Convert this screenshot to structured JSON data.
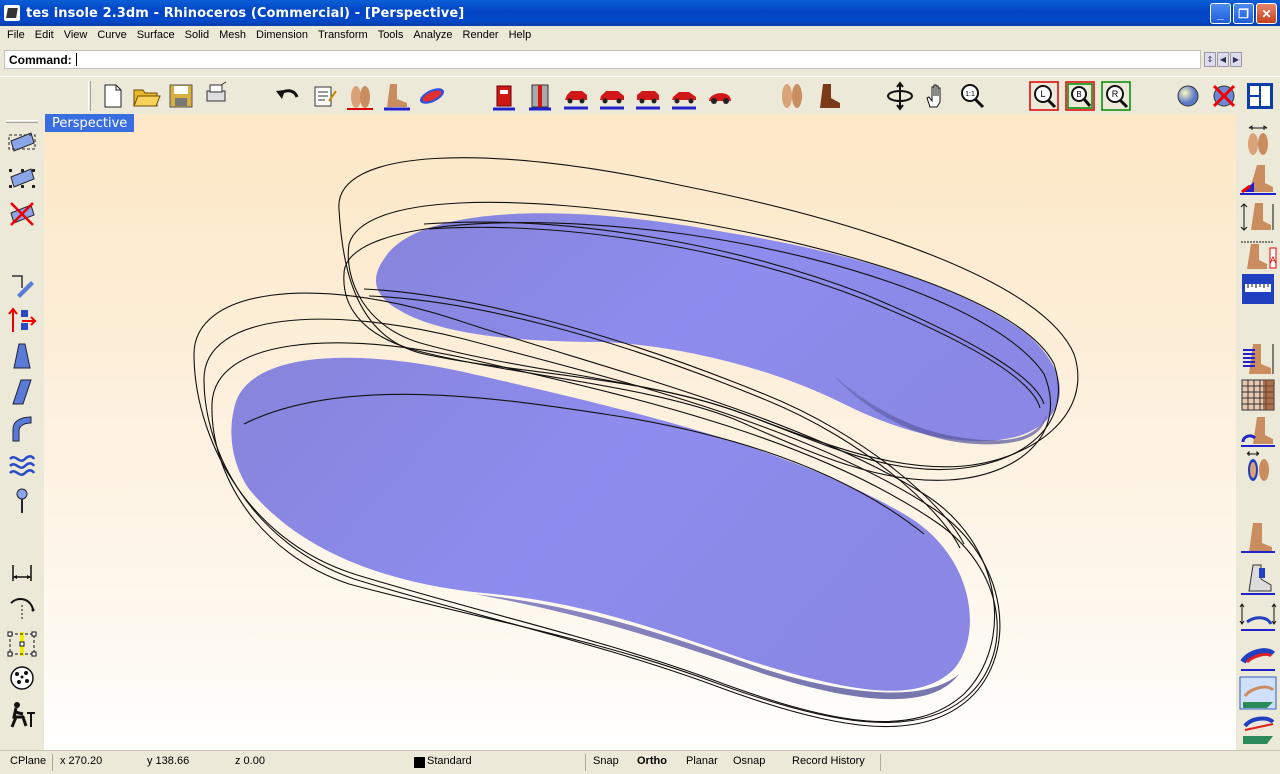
{
  "window": {
    "title": "tes insole 2.3dm - Rhinoceros (Commercial) - [Perspective]"
  },
  "menu": [
    "File",
    "Edit",
    "View",
    "Curve",
    "Surface",
    "Solid",
    "Mesh",
    "Dimension",
    "Transform",
    "Tools",
    "Analyze",
    "Render",
    "Help"
  ],
  "command": {
    "label": "Command:",
    "value": ""
  },
  "viewport": {
    "label": "Perspective"
  },
  "status": {
    "cplane": "CPlane",
    "x": "x 270.20",
    "y": "y 138.66",
    "z": "z 0.00",
    "layer": "Standard",
    "snap": "Snap",
    "ortho": "Ortho",
    "planar": "Planar",
    "osnap": "Osnap",
    "record_history": "Record History"
  },
  "colors": {
    "insole_fill": "#8a86e6",
    "viewport_top": "#fde8c6",
    "viewport_bottom": "#ffffff",
    "titlebar": "#0248c8",
    "label_bg": "#3a6ee0"
  },
  "icons": {
    "top_toolbar": [
      "new-file-icon",
      "open-folder-icon",
      "save-icon",
      "print-icon",
      "undo-icon",
      "properties-icon",
      "feet-pair-icon",
      "foot-side-icon",
      "insole-red-icon",
      "box-red-icon",
      "box-split-icon",
      "car-red-1-icon",
      "car-red-2-icon",
      "car-red-3-icon",
      "car-red-4-icon",
      "beetle-car-icon",
      "feet-pair-2-icon",
      "boot-icon",
      "rotate-view-icon",
      "pan-hand-icon",
      "zoom-1to1-icon",
      "zoom-l-icon",
      "zoom-b-icon",
      "zoom-r-icon",
      "shade-sphere-icon",
      "delete-x-icon",
      "four-viewports-icon"
    ],
    "left_toolbar": [
      "select-object-icon",
      "select-points-icon",
      "deselect-icon",
      "edit-wedge-icon",
      "move-arrows-icon",
      "taper-icon",
      "shear-icon",
      "bend-icon",
      "twist-wave-icon",
      "pin-icon",
      "dimension-icon",
      "arc-curve-icon",
      "box-points-icon",
      "control-dots-icon",
      "person-chair-icon"
    ],
    "right_toolbar": [
      "foot-width-icon",
      "foot-heel-icon",
      "foot-height-icon",
      "foot-annotate-icon",
      "ruler-icon",
      "foot-stripes-icon",
      "grid-foot-icon",
      "heel-cup-icon",
      "foot-sole-icon",
      "foot-side-2-icon",
      "toe-foot-icon",
      "arrow-insole-icon",
      "insole-blue-icon",
      "insole-layer-icon",
      "insole-wedge-icon"
    ]
  }
}
